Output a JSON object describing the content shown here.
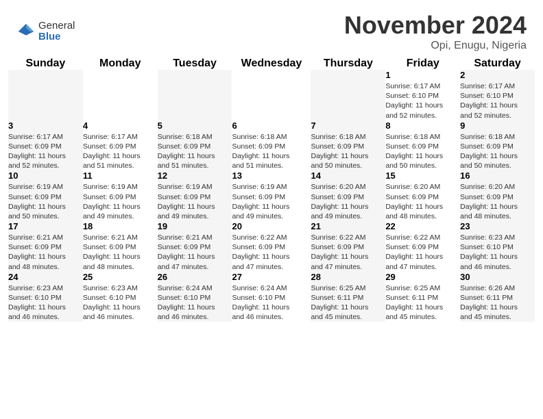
{
  "logo": {
    "general": "General",
    "blue": "Blue"
  },
  "title": "November 2024",
  "location": "Opi, Enugu, Nigeria",
  "weekdays": [
    "Sunday",
    "Monday",
    "Tuesday",
    "Wednesday",
    "Thursday",
    "Friday",
    "Saturday"
  ],
  "weeks": [
    [
      {
        "day": "",
        "info": ""
      },
      {
        "day": "",
        "info": ""
      },
      {
        "day": "",
        "info": ""
      },
      {
        "day": "",
        "info": ""
      },
      {
        "day": "",
        "info": ""
      },
      {
        "day": "1",
        "info": "Sunrise: 6:17 AM\nSunset: 6:10 PM\nDaylight: 11 hours\nand 52 minutes."
      },
      {
        "day": "2",
        "info": "Sunrise: 6:17 AM\nSunset: 6:10 PM\nDaylight: 11 hours\nand 52 minutes."
      }
    ],
    [
      {
        "day": "3",
        "info": "Sunrise: 6:17 AM\nSunset: 6:09 PM\nDaylight: 11 hours\nand 52 minutes."
      },
      {
        "day": "4",
        "info": "Sunrise: 6:17 AM\nSunset: 6:09 PM\nDaylight: 11 hours\nand 51 minutes."
      },
      {
        "day": "5",
        "info": "Sunrise: 6:18 AM\nSunset: 6:09 PM\nDaylight: 11 hours\nand 51 minutes."
      },
      {
        "day": "6",
        "info": "Sunrise: 6:18 AM\nSunset: 6:09 PM\nDaylight: 11 hours\nand 51 minutes."
      },
      {
        "day": "7",
        "info": "Sunrise: 6:18 AM\nSunset: 6:09 PM\nDaylight: 11 hours\nand 50 minutes."
      },
      {
        "day": "8",
        "info": "Sunrise: 6:18 AM\nSunset: 6:09 PM\nDaylight: 11 hours\nand 50 minutes."
      },
      {
        "day": "9",
        "info": "Sunrise: 6:18 AM\nSunset: 6:09 PM\nDaylight: 11 hours\nand 50 minutes."
      }
    ],
    [
      {
        "day": "10",
        "info": "Sunrise: 6:19 AM\nSunset: 6:09 PM\nDaylight: 11 hours\nand 50 minutes."
      },
      {
        "day": "11",
        "info": "Sunrise: 6:19 AM\nSunset: 6:09 PM\nDaylight: 11 hours\nand 49 minutes."
      },
      {
        "day": "12",
        "info": "Sunrise: 6:19 AM\nSunset: 6:09 PM\nDaylight: 11 hours\nand 49 minutes."
      },
      {
        "day": "13",
        "info": "Sunrise: 6:19 AM\nSunset: 6:09 PM\nDaylight: 11 hours\nand 49 minutes."
      },
      {
        "day": "14",
        "info": "Sunrise: 6:20 AM\nSunset: 6:09 PM\nDaylight: 11 hours\nand 49 minutes."
      },
      {
        "day": "15",
        "info": "Sunrise: 6:20 AM\nSunset: 6:09 PM\nDaylight: 11 hours\nand 48 minutes."
      },
      {
        "day": "16",
        "info": "Sunrise: 6:20 AM\nSunset: 6:09 PM\nDaylight: 11 hours\nand 48 minutes."
      }
    ],
    [
      {
        "day": "17",
        "info": "Sunrise: 6:21 AM\nSunset: 6:09 PM\nDaylight: 11 hours\nand 48 minutes."
      },
      {
        "day": "18",
        "info": "Sunrise: 6:21 AM\nSunset: 6:09 PM\nDaylight: 11 hours\nand 48 minutes."
      },
      {
        "day": "19",
        "info": "Sunrise: 6:21 AM\nSunset: 6:09 PM\nDaylight: 11 hours\nand 47 minutes."
      },
      {
        "day": "20",
        "info": "Sunrise: 6:22 AM\nSunset: 6:09 PM\nDaylight: 11 hours\nand 47 minutes."
      },
      {
        "day": "21",
        "info": "Sunrise: 6:22 AM\nSunset: 6:09 PM\nDaylight: 11 hours\nand 47 minutes."
      },
      {
        "day": "22",
        "info": "Sunrise: 6:22 AM\nSunset: 6:09 PM\nDaylight: 11 hours\nand 47 minutes."
      },
      {
        "day": "23",
        "info": "Sunrise: 6:23 AM\nSunset: 6:10 PM\nDaylight: 11 hours\nand 46 minutes."
      }
    ],
    [
      {
        "day": "24",
        "info": "Sunrise: 6:23 AM\nSunset: 6:10 PM\nDaylight: 11 hours\nand 46 minutes."
      },
      {
        "day": "25",
        "info": "Sunrise: 6:23 AM\nSunset: 6:10 PM\nDaylight: 11 hours\nand 46 minutes."
      },
      {
        "day": "26",
        "info": "Sunrise: 6:24 AM\nSunset: 6:10 PM\nDaylight: 11 hours\nand 46 minutes."
      },
      {
        "day": "27",
        "info": "Sunrise: 6:24 AM\nSunset: 6:10 PM\nDaylight: 11 hours\nand 46 minutes."
      },
      {
        "day": "28",
        "info": "Sunrise: 6:25 AM\nSunset: 6:11 PM\nDaylight: 11 hours\nand 45 minutes."
      },
      {
        "day": "29",
        "info": "Sunrise: 6:25 AM\nSunset: 6:11 PM\nDaylight: 11 hours\nand 45 minutes."
      },
      {
        "day": "30",
        "info": "Sunrise: 6:26 AM\nSunset: 6:11 PM\nDaylight: 11 hours\nand 45 minutes."
      }
    ]
  ]
}
